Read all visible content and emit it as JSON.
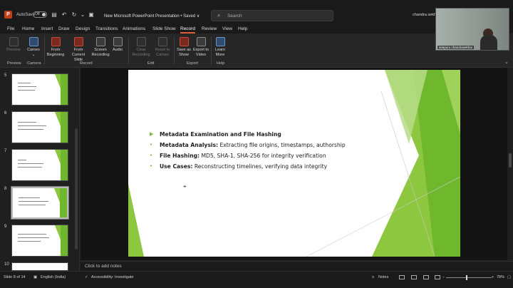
{
  "titlebar": {
    "app_icon": "powerpoint-icon",
    "autosave_label": "AutoSave",
    "autosave_state": "Off",
    "doc_title": "New Microsoft PowerPoint Presentation • Saved ∨",
    "search_placeholder": "Search",
    "user_name": "chandra sekha"
  },
  "tabs": [
    "File",
    "Home",
    "Insert",
    "Draw",
    "Design",
    "Transitions",
    "Animations",
    "Slide Show",
    "Record",
    "Review",
    "View",
    "Help"
  ],
  "active_tab": "Record",
  "ribbon": {
    "preview": "Preview",
    "cameo": "Cameo",
    "from_beginning": "From Beginning",
    "from_current": "From Current Slide",
    "screen_recording": "Screen Recording",
    "audio": "Audio",
    "clear_recording": "Clear Recording",
    "reset_cameo": "Reset to Cameo",
    "save_as_show": "Save as Show",
    "export_video": "Export to Video",
    "learn_more": "Learn More",
    "groups": [
      "Preview",
      "Camera",
      "Record",
      "Edit",
      "Export",
      "Help"
    ]
  },
  "webcam": {
    "label": "seepuru chandrasekhar"
  },
  "thumbnails": [
    {
      "num": "5"
    },
    {
      "num": "6"
    },
    {
      "num": "7"
    },
    {
      "num": "8",
      "selected": true
    },
    {
      "num": "9"
    },
    {
      "num": "10"
    }
  ],
  "slide": {
    "title": "Metadata Examination and File Hashing",
    "bullets": [
      {
        "label": "Metadata Analysis:",
        "text": " Extracting file origins, timestamps, authorship"
      },
      {
        "label": "File Hashing:",
        "text": " MD5, SHA-1, SHA-256 for integrity verification"
      },
      {
        "label": "Use Cases:",
        "text": " Reconstructing timelines, verifying data integrity"
      }
    ],
    "accent": "#7ab648"
  },
  "notes": {
    "placeholder": "Click to add notes"
  },
  "status": {
    "slide_count": "Slide 8 of 14",
    "language": "English (India)",
    "accessibility": "Accessibility: Investigate",
    "notes_btn": "Notes",
    "zoom": "78%"
  }
}
